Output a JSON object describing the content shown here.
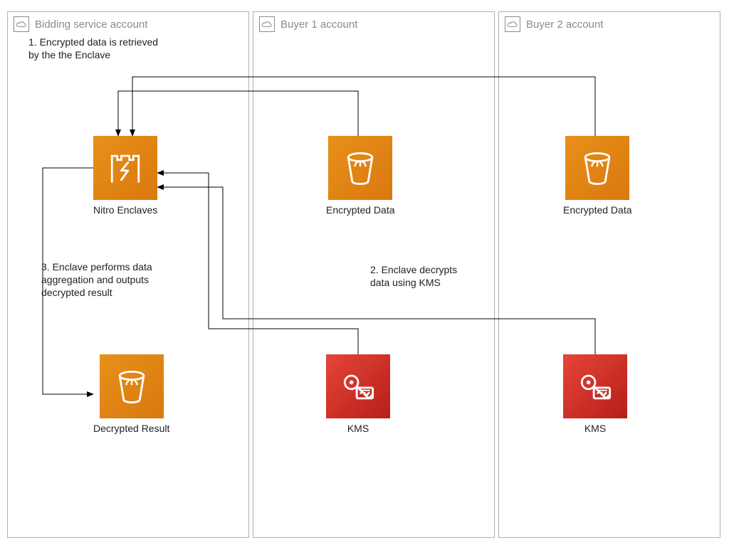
{
  "groups": {
    "bidding": {
      "title": "Bidding service account"
    },
    "buyer1": {
      "title": "Buyer 1 account"
    },
    "buyer2": {
      "title": "Buyer 2 account"
    }
  },
  "nodes": {
    "nitro": {
      "label": "Nitro Enclaves",
      "icon": "nitro-enclaves-icon",
      "color_start": "#e8901a",
      "color_end": "#d9780f"
    },
    "decrypted": {
      "label": "Decrypted Result",
      "icon": "bucket-icon",
      "color_start": "#e8901a",
      "color_end": "#d9780f"
    },
    "buyer1_data": {
      "label": "Encrypted Data",
      "icon": "bucket-icon",
      "color_start": "#e8901a",
      "color_end": "#d9780f"
    },
    "buyer1_kms": {
      "label": "KMS",
      "icon": "kms-icon",
      "color_start": "#e6453a",
      "color_end": "#b51f17"
    },
    "buyer2_data": {
      "label": "Encrypted Data",
      "icon": "bucket-icon",
      "color_start": "#e8901a",
      "color_end": "#d9780f"
    },
    "buyer2_kms": {
      "label": "KMS",
      "icon": "kms-icon",
      "color_start": "#e6453a",
      "color_end": "#b51f17"
    }
  },
  "annotations": {
    "step1": "1. Encrypted data is retrieved\n    by the the Enclave",
    "step2": "2. Enclave decrypts\n    data using KMS",
    "step3": "3. Enclave performs data\n    aggregation and outputs\n    decrypted result"
  },
  "arrows": [
    {
      "from": "buyer1_data",
      "to": "nitro"
    },
    {
      "from": "buyer2_data",
      "to": "nitro"
    },
    {
      "from": "buyer1_kms",
      "to": "nitro"
    },
    {
      "from": "buyer2_kms",
      "to": "nitro"
    },
    {
      "from": "nitro",
      "to": "decrypted"
    }
  ],
  "colors": {
    "group_border": "#b0b0b0",
    "text_muted": "#8a8a8a",
    "text": "#222",
    "arrow": "#000"
  }
}
